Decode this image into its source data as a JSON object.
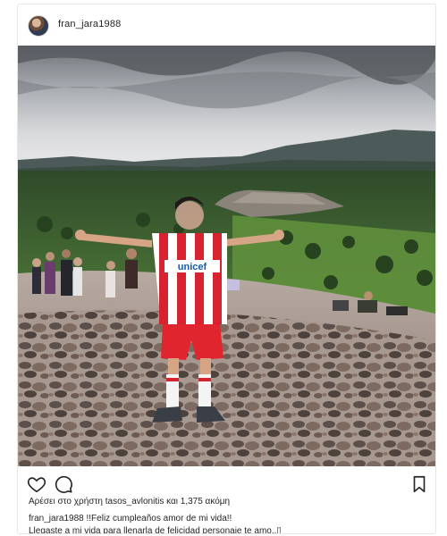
{
  "post": {
    "username": "fran_jara1988",
    "likes_text": "Αρέσει στο χρήστη tasos_avlonitis και 1,375 ακόμη",
    "caption_user": "fran_jara1988",
    "caption_line1": " !!Feliz cumpleaños amor de mi vida!!",
    "caption_line2": "Llegaste a mi vida para llenarla de felicidad personaje te amo..▯",
    "shirt_text": "unicef"
  },
  "icons": {
    "like": "heart-outline-icon",
    "comment": "comment-bubble-icon",
    "save": "bookmark-icon"
  },
  "colors": {
    "text": "#262626",
    "border": "#e6e6e6",
    "shirt_red": "#d7232f",
    "sky": "#b9bcc0"
  }
}
